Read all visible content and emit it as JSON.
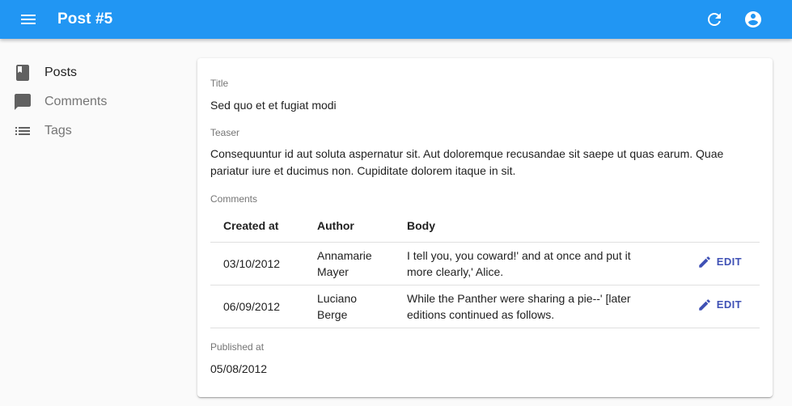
{
  "appbar": {
    "title": "Post #5",
    "menu_icon": "menu-icon",
    "refresh_icon": "refresh-icon",
    "account_icon": "account-circle-icon",
    "color": "#2196f3"
  },
  "sidebar": {
    "items": [
      {
        "label": "Posts",
        "icon": "book-icon",
        "active": true
      },
      {
        "label": "Comments",
        "icon": "chat-bubble-icon",
        "active": false
      },
      {
        "label": "Tags",
        "icon": "list-icon",
        "active": false
      }
    ]
  },
  "post": {
    "title_label": "Title",
    "title": "Sed quo et et fugiat modi",
    "teaser_label": "Teaser",
    "teaser": "Consequuntur id aut soluta aspernatur sit. Aut doloremque recusandae sit saepe ut quas earum. Quae pariatur iure et ducimus non. Cupiditate dolorem itaque in sit.",
    "comments_label": "Comments",
    "published_label": "Published at",
    "published_at": "05/08/2012"
  },
  "comments_table": {
    "headers": {
      "created_at": "Created at",
      "author": "Author",
      "body": "Body"
    },
    "rows": [
      {
        "created_at": "03/10/2012",
        "author": "Annamarie Mayer",
        "body": "I tell you, you coward!' and at once and put it more clearly,' Alice.",
        "edit_label": "EDIT"
      },
      {
        "created_at": "06/09/2012",
        "author": "Luciano Berge",
        "body": "While the Panther were sharing a pie--' [later editions continued as follows.",
        "edit_label": "EDIT"
      }
    ]
  },
  "colors": {
    "accent": "#3f51b5",
    "appbar": "#2196f3"
  }
}
